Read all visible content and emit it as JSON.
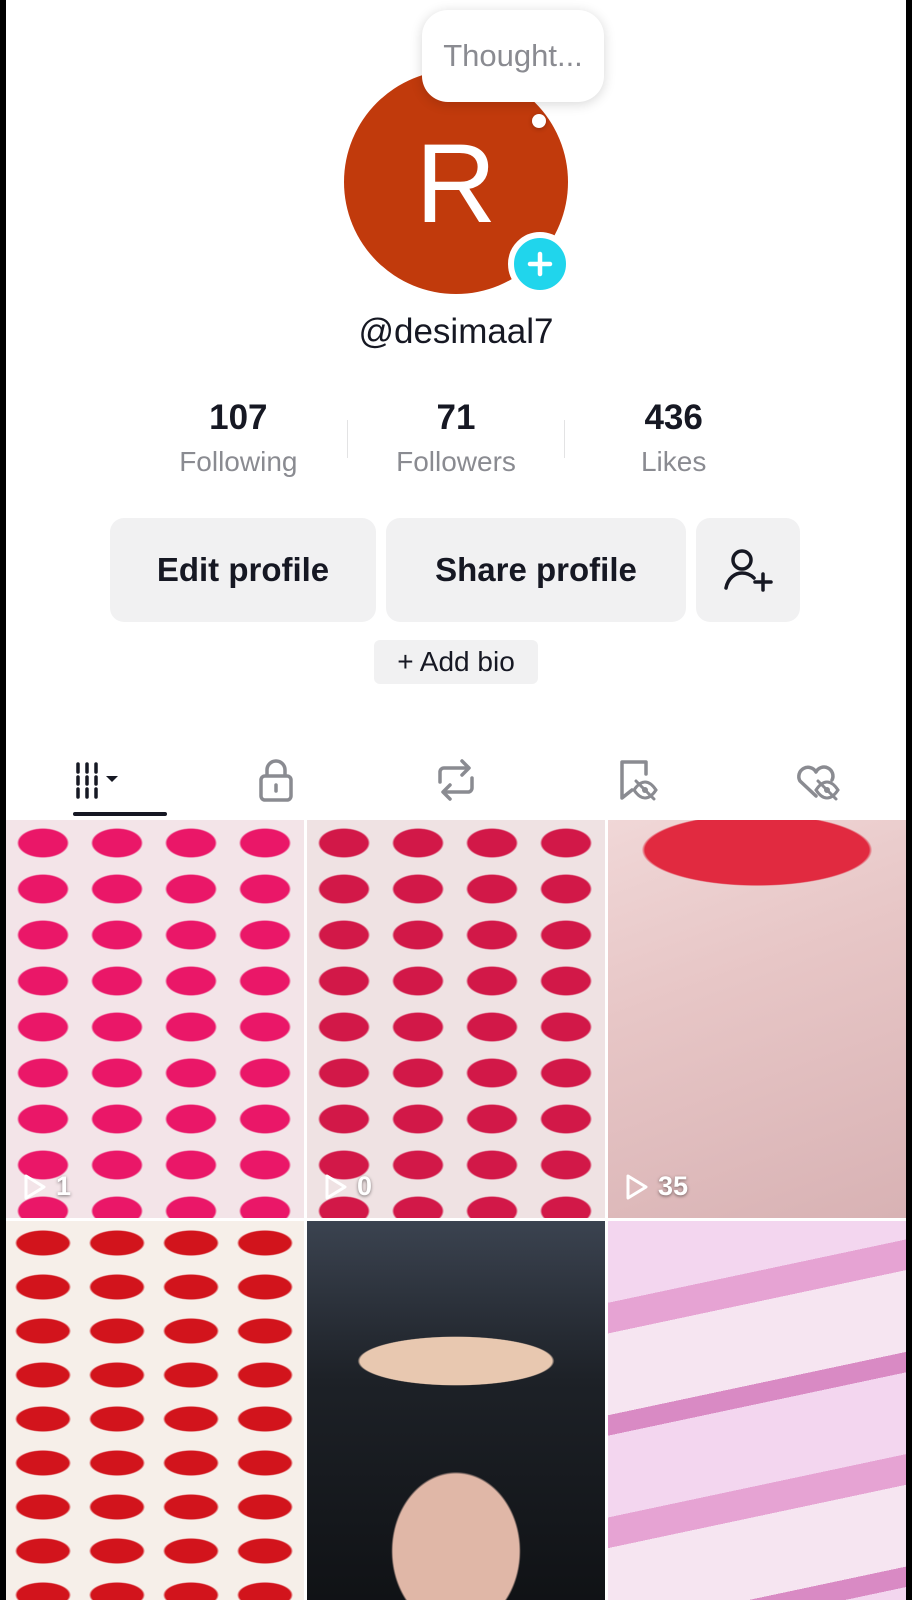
{
  "profile": {
    "thought_text": "Thought...",
    "avatar_letter": "R",
    "username": "@desimaal7"
  },
  "stats": [
    {
      "value": "107",
      "label": "Following"
    },
    {
      "value": "71",
      "label": "Followers"
    },
    {
      "value": "436",
      "label": "Likes"
    }
  ],
  "actions": {
    "edit_profile": "Edit profile",
    "share_profile": "Share profile",
    "add_bio": "+ Add bio"
  },
  "tabs": [
    {
      "icon": "videos-grid-icon",
      "active": true
    },
    {
      "icon": "lock-icon",
      "active": false
    },
    {
      "icon": "repost-icon",
      "active": false
    },
    {
      "icon": "bookmark-hidden-icon",
      "active": false
    },
    {
      "icon": "heart-hidden-icon",
      "active": false
    }
  ],
  "videos": [
    {
      "views": "1"
    },
    {
      "views": "0"
    },
    {
      "views": "35"
    },
    {
      "views": ""
    },
    {
      "views": ""
    },
    {
      "views": ""
    }
  ],
  "colors": {
    "avatar_bg": "#c13a0c",
    "add_badge": "#20d5ec",
    "button_bg": "#f1f1f2",
    "secondary_text": "#8a8b91"
  }
}
